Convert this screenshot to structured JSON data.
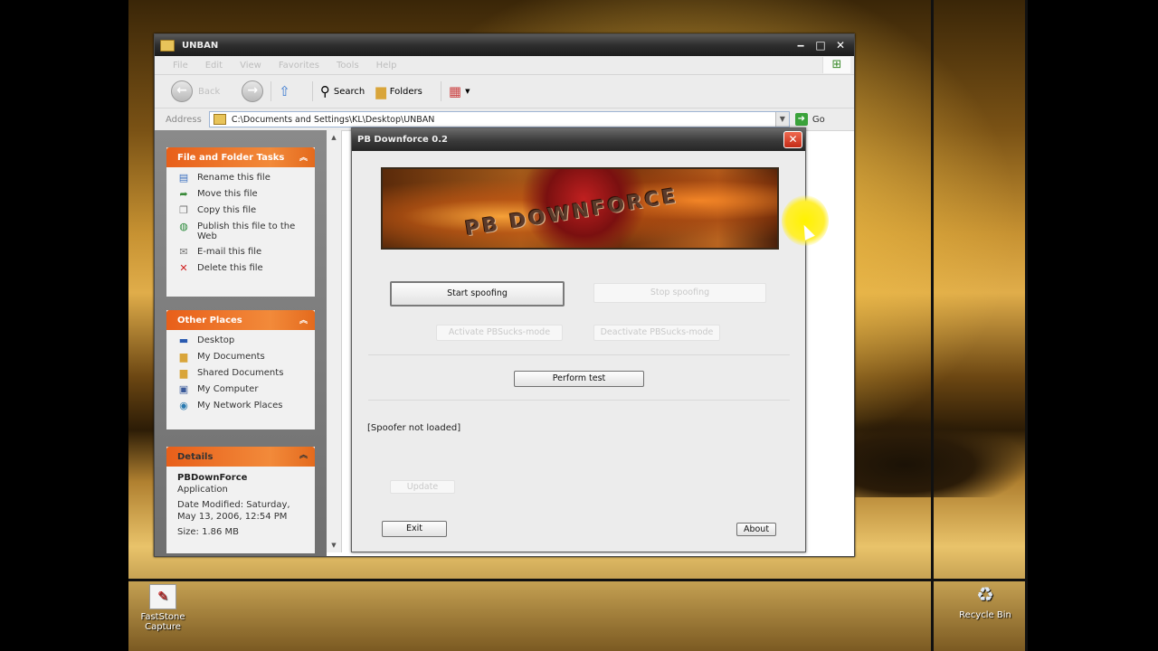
{
  "desktop": {
    "icons": [
      {
        "label": "FastStone Capture",
        "icon": "faststone-icon"
      },
      {
        "label": "Recycle Bin",
        "icon": "recycle-bin-icon"
      }
    ]
  },
  "explorer": {
    "title": "UNBAN",
    "menu": [
      "File",
      "Edit",
      "View",
      "Favorites",
      "Tools",
      "Help"
    ],
    "toolbar": {
      "back": "Back",
      "search": "Search",
      "folders": "Folders"
    },
    "address": {
      "label": "Address",
      "value": "C:\\Documents and Settings\\KL\\Desktop\\UNBAN",
      "go": "Go"
    },
    "file_tasks": {
      "header": "File and Folder Tasks",
      "items": [
        "Rename this file",
        "Move this file",
        "Copy this file",
        "Publish this file to the Web",
        "E-mail this file",
        "Delete this file"
      ]
    },
    "other_places": {
      "header": "Other Places",
      "items": [
        "Desktop",
        "My Documents",
        "Shared Documents",
        "My Computer",
        "My Network Places"
      ]
    },
    "details": {
      "header": "Details",
      "name": "PBDownForce",
      "type": "Application",
      "modified": "Date Modified: Saturday, May 13, 2006, 12:54 PM",
      "size": "Size: 1.86 MB"
    }
  },
  "dialog": {
    "title": "PB Downforce 0.2",
    "banner_text": "PB DOWNFORCE",
    "start": "Start spoofing",
    "stop": "Stop spoofing",
    "activate": "Activate PBSucks-mode",
    "deactivate": "Deactivate PBSucks-mode",
    "test": "Perform test",
    "status": "[Spoofer not loaded]",
    "update": "Update",
    "exit": "Exit",
    "about": "About"
  }
}
